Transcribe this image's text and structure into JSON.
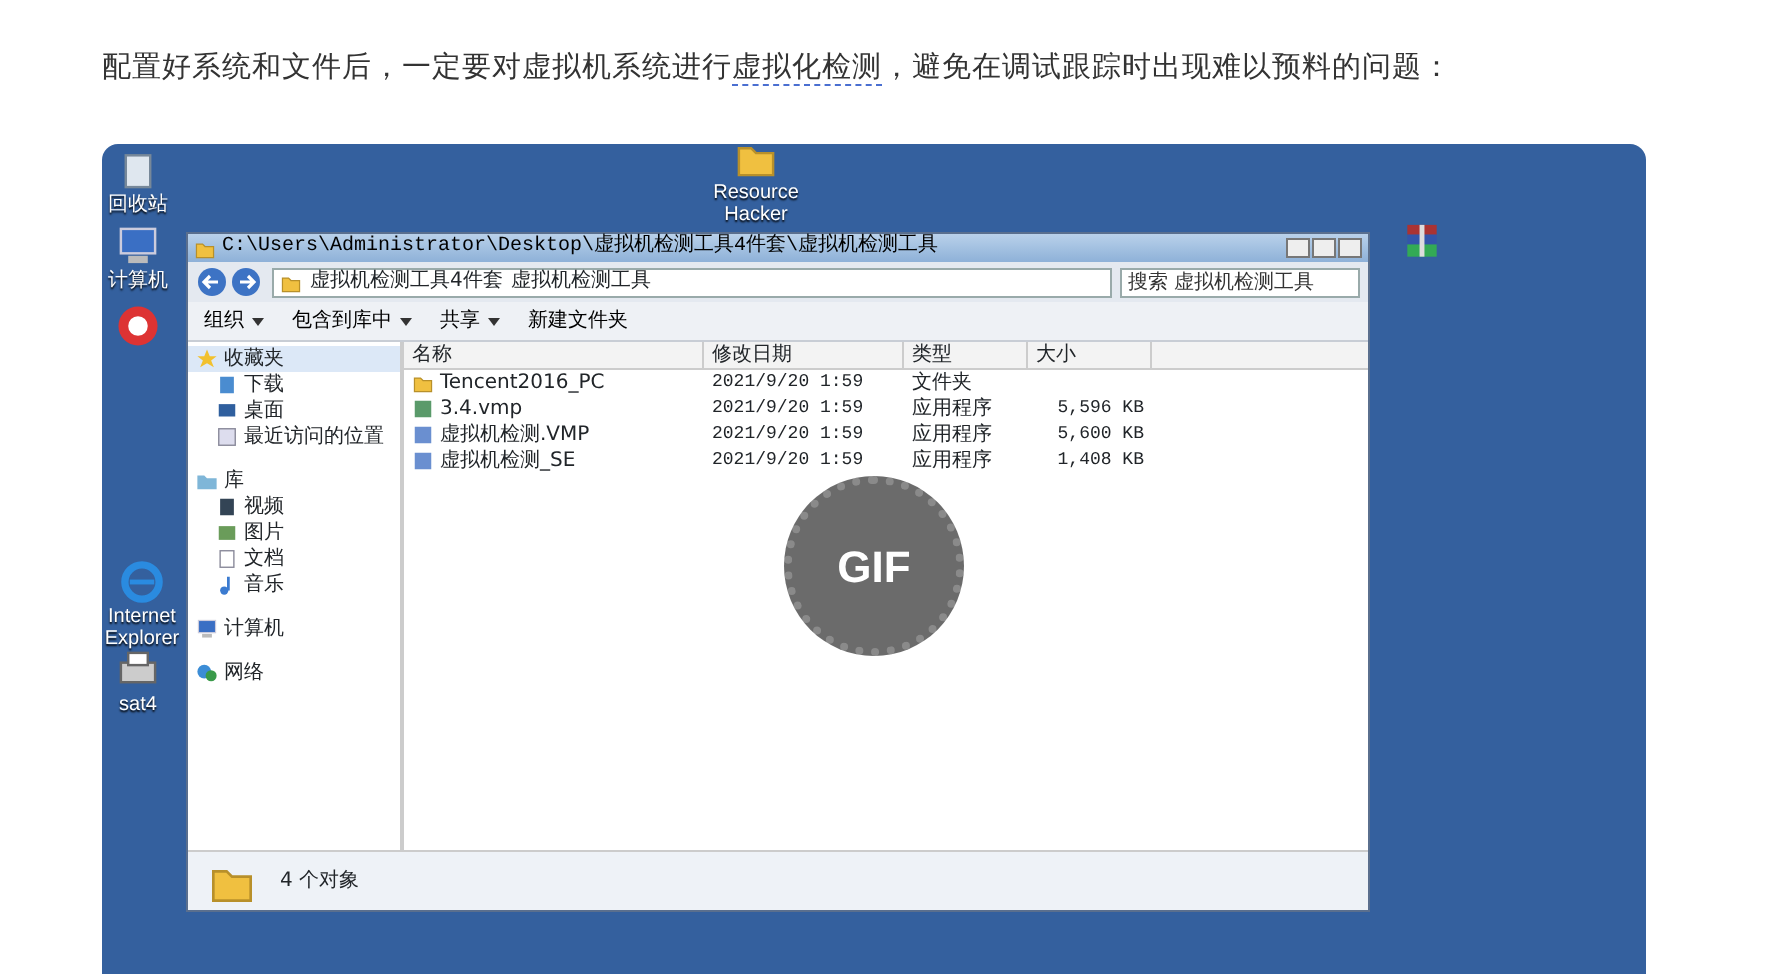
{
  "article": {
    "paragraph": {
      "before": "配置好系统和文件后，一定要对虚拟机系统进行",
      "link": "虚拟化检测",
      "after": "，避免在调试跟踪时出现难以预料的问题："
    }
  },
  "gif": {
    "badge": "GIF",
    "desktop_icons": [
      {
        "label": "回收站",
        "kind": "bin"
      },
      {
        "label": "计算机",
        "kind": "computer"
      },
      {
        "kind": "cleaner"
      },
      {
        "label": "Internet Explorer",
        "kind": "ie"
      },
      {
        "label": "sat4",
        "kind": "printer"
      },
      {
        "label": "Resource Hacker",
        "kind": "folder"
      },
      {
        "kind": "archive"
      }
    ],
    "explorer": {
      "title": "C:\\Users\\Administrator\\Desktop\\虚拟机检测工具4件套\\虚拟机检测工具",
      "path": [
        "虚拟机检测工具4件套",
        "虚拟机检测工具"
      ],
      "search": {
        "placeholder": "搜索 虚拟机检测工具"
      },
      "toolbar": [
        {
          "label": "组织",
          "dropdown": true
        },
        {
          "label": "包含到库中",
          "dropdown": true
        },
        {
          "label": "共享",
          "dropdown": true
        },
        {
          "label": "新建文件夹",
          "dropdown": false
        }
      ],
      "nav": [
        {
          "label": "收藏夹",
          "kind": "star",
          "selected": true,
          "children": [
            {
              "label": "下载",
              "kind": "download",
              "selected": false
            },
            {
              "label": "桌面",
              "kind": "desktop",
              "selected": false
            },
            {
              "label": "最近访问的位置",
              "kind": "recent",
              "selected": false
            }
          ]
        },
        {
          "label": "库",
          "kind": "library",
          "selected": false,
          "children": [
            {
              "label": "视频",
              "kind": "video",
              "selected": false
            },
            {
              "label": "图片",
              "kind": "picture",
              "selected": false
            },
            {
              "label": "文档",
              "kind": "document",
              "selected": false
            },
            {
              "label": "音乐",
              "kind": "music",
              "selected": false
            }
          ]
        },
        {
          "label": "计算机",
          "kind": "computer",
          "selected": false
        },
        {
          "label": "网络",
          "kind": "network",
          "selected": false
        }
      ],
      "columns": [
        "名称",
        "修改日期",
        "类型",
        "大小"
      ],
      "rows": [
        {
          "name": "Tencent2016_PC",
          "date": "2021/9/20 1:59",
          "type": "文件夹",
          "kind": "folder"
        },
        {
          "name": "3.4.vmp",
          "date": "2021/9/20 1:59",
          "type": "应用程序",
          "size": "5,596 KB",
          "kind": "vmp"
        },
        {
          "name": "虚拟机检测.VMP",
          "date": "2021/9/20 1:59",
          "type": "应用程序",
          "size": "5,600 KB",
          "kind": "app"
        },
        {
          "name": "虚拟机检测_SE",
          "date": "2021/9/20 1:59",
          "type": "应用程序",
          "size": "1,408 KB",
          "kind": "app"
        }
      ],
      "status": "4 个对象"
    }
  }
}
